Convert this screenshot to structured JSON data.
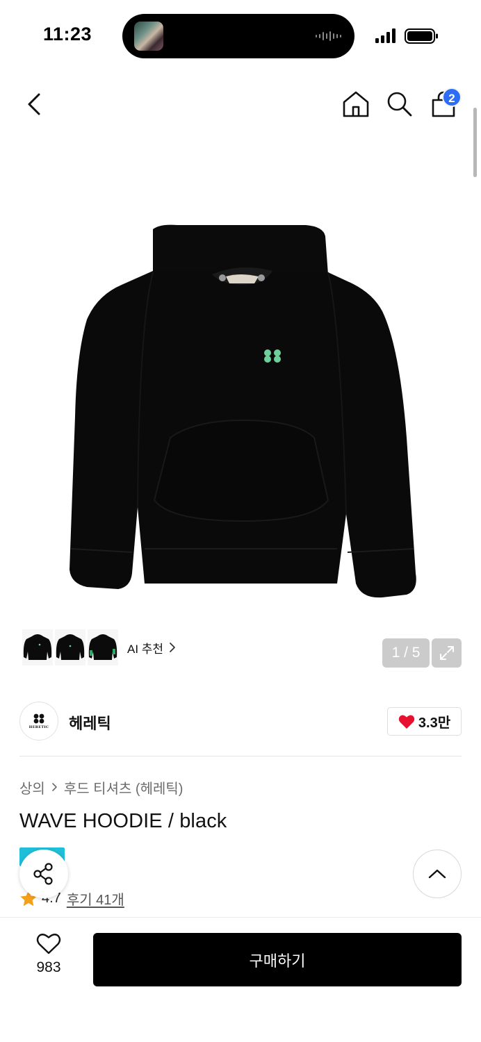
{
  "status_bar": {
    "time": "11:23",
    "icons": [
      "cellular-signal-icon",
      "battery-icon"
    ]
  },
  "nav": {
    "icons": [
      "back-chevron-icon",
      "home-icon",
      "search-icon",
      "shopping-bag-icon"
    ],
    "cart_count": "2"
  },
  "gallery": {
    "ai_recommend_label": "AI 추천",
    "page_counter": "1 / 5",
    "logo_color": "#6fcf9a"
  },
  "brand": {
    "name": "헤레틱",
    "logo_text": "HERETIC",
    "like_count": "3.3만"
  },
  "product": {
    "breadcrumb": [
      "상의",
      "후드 티셔츠 (헤레틱)"
    ],
    "title": "WAVE HOODIE / black",
    "rating": "4.7",
    "review_link": "후기 41개",
    "accent_color": "#1fbfd9"
  },
  "bottom_bar": {
    "wish_count": "983",
    "buy_label": "구매하기"
  }
}
